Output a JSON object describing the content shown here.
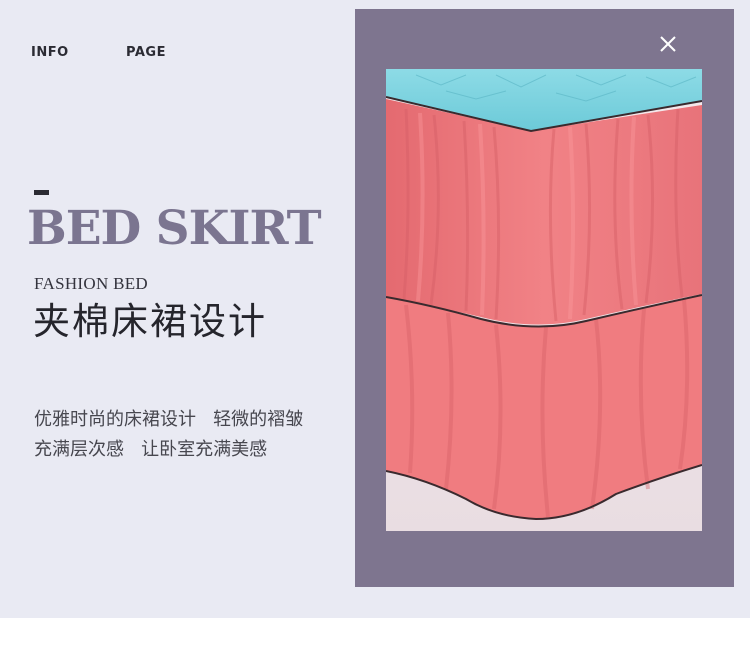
{
  "nav": {
    "info_label": "INFO",
    "page_label": "PAGE"
  },
  "hero": {
    "title": "BED SKIRT",
    "subtitle_en": "FASHION BED",
    "subtitle_cn": "夹棉床裙设计",
    "body_lines": [
      "优雅时尚的床裙设计   轻微的褶皱",
      "充满层次感   让卧室充满美感"
    ]
  },
  "icons": {
    "close": "close-icon"
  },
  "colors": {
    "background": "#e9eaf3",
    "frame": "#7e758f",
    "title": "#7b7590",
    "skirt": "#ef7d80",
    "quilt": "#7fd4e0"
  }
}
